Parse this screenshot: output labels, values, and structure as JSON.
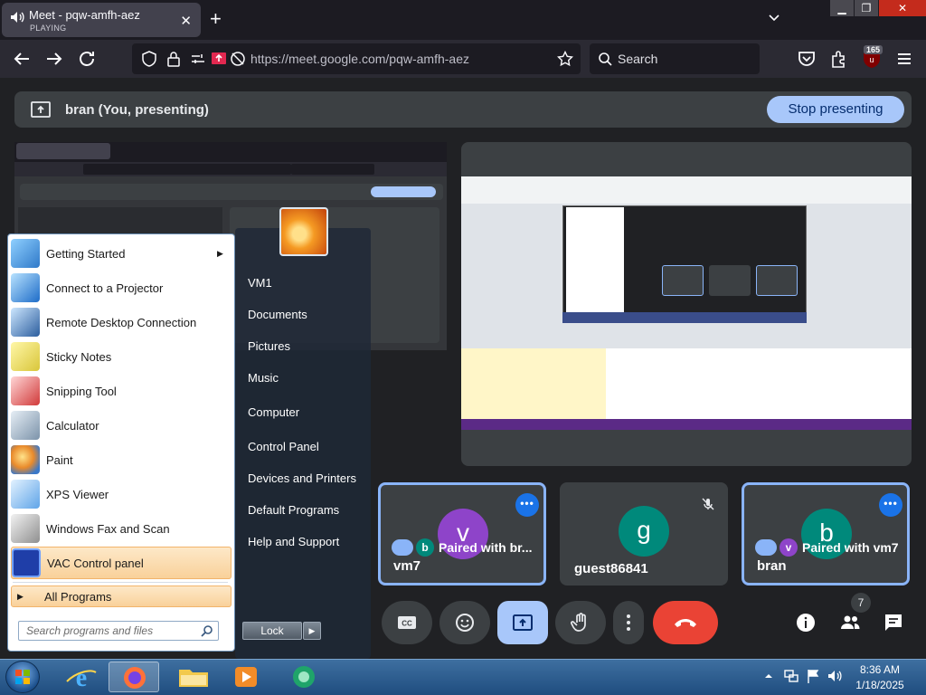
{
  "browser": {
    "tab_title": "Meet - pqw-amfh-aez",
    "tab_status": "PLAYING",
    "url": "https://meet.google.com/pqw-amfh-aez",
    "search_label": "Search",
    "extensions_badge": "165"
  },
  "meet": {
    "presenting_label": "bran (You, presenting)",
    "stop_presenting": "Stop presenting",
    "participants": [
      {
        "name": "vm7",
        "avatar_letter": "v",
        "paired_label": "Paired with br...",
        "paired_mini": "b",
        "avatar_color": "#8e44c9"
      },
      {
        "name": "guest86841",
        "avatar_letter": "g",
        "avatar_color": "#00897b"
      },
      {
        "name": "bran",
        "avatar_letter": "b",
        "paired_label": "Paired with vm7",
        "paired_mini": "v",
        "avatar_color": "#00897b"
      }
    ],
    "participant_count": "7"
  },
  "startmenu": {
    "programs": [
      {
        "label": "Getting Started",
        "icon": "getting-started-icon"
      },
      {
        "label": "Connect to a Projector",
        "icon": "projector-icon"
      },
      {
        "label": "Remote Desktop Connection",
        "icon": "remote-desktop-icon"
      },
      {
        "label": "Sticky Notes",
        "icon": "sticky-notes-icon"
      },
      {
        "label": "Snipping Tool",
        "icon": "snipping-tool-icon"
      },
      {
        "label": "Calculator",
        "icon": "calculator-icon"
      },
      {
        "label": "Paint",
        "icon": "paint-icon"
      },
      {
        "label": "XPS Viewer",
        "icon": "xps-viewer-icon"
      },
      {
        "label": "Windows Fax and Scan",
        "icon": "fax-scan-icon"
      },
      {
        "label": "VAC Control panel",
        "icon": "vac-icon"
      }
    ],
    "all_programs": "All Programs",
    "search_placeholder": "Search programs and files",
    "right_items": [
      "VM1",
      "Documents",
      "Pictures",
      "Music",
      "Computer",
      "Control Panel",
      "Devices and Printers",
      "Default Programs",
      "Help and Support"
    ],
    "lock_label": "Lock"
  },
  "taskbar": {
    "time": "8:36 AM",
    "date": "1/18/2025"
  }
}
